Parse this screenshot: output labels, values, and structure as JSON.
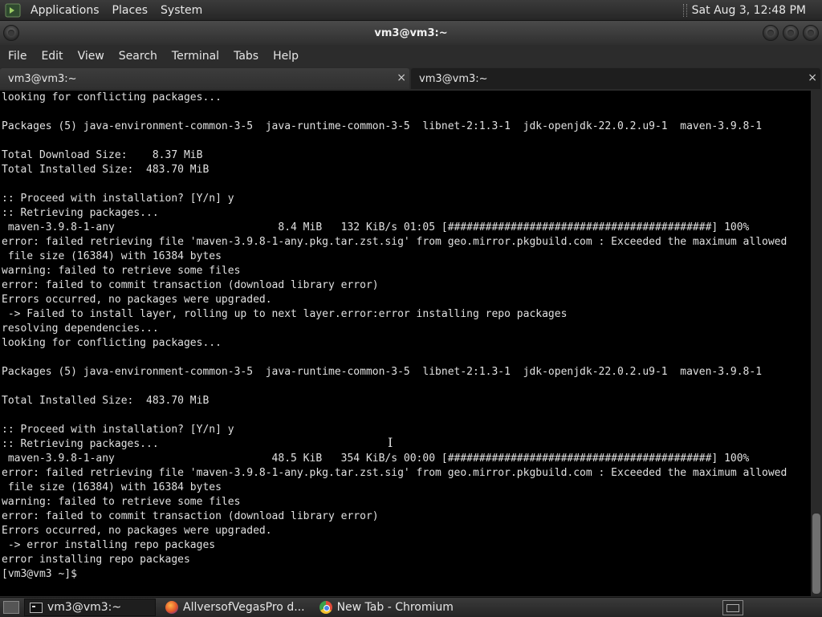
{
  "top_panel": {
    "menus": [
      "Applications",
      "Places",
      "System"
    ],
    "clock": "Sat Aug  3, 12:48 PM"
  },
  "window": {
    "title": "vm3@vm3:~"
  },
  "menubar": {
    "items": [
      "File",
      "Edit",
      "View",
      "Search",
      "Terminal",
      "Tabs",
      "Help"
    ]
  },
  "tabs": [
    {
      "label": "vm3@vm3:~",
      "close": "×"
    },
    {
      "label": "vm3@vm3:~",
      "close": "×"
    }
  ],
  "terminal": {
    "lines": [
      "looking for conflicting packages...",
      "",
      "Packages (5) java-environment-common-3-5  java-runtime-common-3-5  libnet-2:1.3-1  jdk-openjdk-22.0.2.u9-1  maven-3.9.8-1",
      "",
      "Total Download Size:    8.37 MiB",
      "Total Installed Size:  483.70 MiB",
      "",
      ":: Proceed with installation? [Y/n] y",
      ":: Retrieving packages...",
      " maven-3.9.8-1-any                          8.4 MiB   132 KiB/s 01:05 [##########################################] 100%",
      "error: failed retrieving file 'maven-3.9.8-1-any.pkg.tar.zst.sig' from geo.mirror.pkgbuild.com : Exceeded the maximum allowed",
      " file size (16384) with 16384 bytes",
      "warning: failed to retrieve some files",
      "error: failed to commit transaction (download library error)",
      "Errors occurred, no packages were upgraded.",
      " -> Failed to install layer, rolling up to next layer.error:error installing repo packages",
      "resolving dependencies...",
      "looking for conflicting packages...",
      "",
      "Packages (5) java-environment-common-3-5  java-runtime-common-3-5  libnet-2:1.3-1  jdk-openjdk-22.0.2.u9-1  maven-3.9.8-1",
      "",
      "Total Installed Size:  483.70 MiB",
      "",
      ":: Proceed with installation? [Y/n] y",
      ":: Retrieving packages...",
      " maven-3.9.8-1-any                         48.5 KiB   354 KiB/s 00:00 [##########################################] 100%",
      "error: failed retrieving file 'maven-3.9.8-1-any.pkg.tar.zst.sig' from geo.mirror.pkgbuild.com : Exceeded the maximum allowed",
      " file size (16384) with 16384 bytes",
      "warning: failed to retrieve some files",
      "error: failed to commit transaction (download library error)",
      "Errors occurred, no packages were upgraded.",
      " -> error installing repo packages",
      "error installing repo packages",
      "[vm3@vm3 ~]$ "
    ]
  },
  "taskbar": {
    "tasks": [
      {
        "label": "vm3@vm3:~",
        "icon": "terminal-icon"
      },
      {
        "label": "AllversofVegasPro d...",
        "icon": "firefox-icon"
      },
      {
        "label": "New Tab - Chromium",
        "icon": "chromium-icon"
      }
    ]
  }
}
